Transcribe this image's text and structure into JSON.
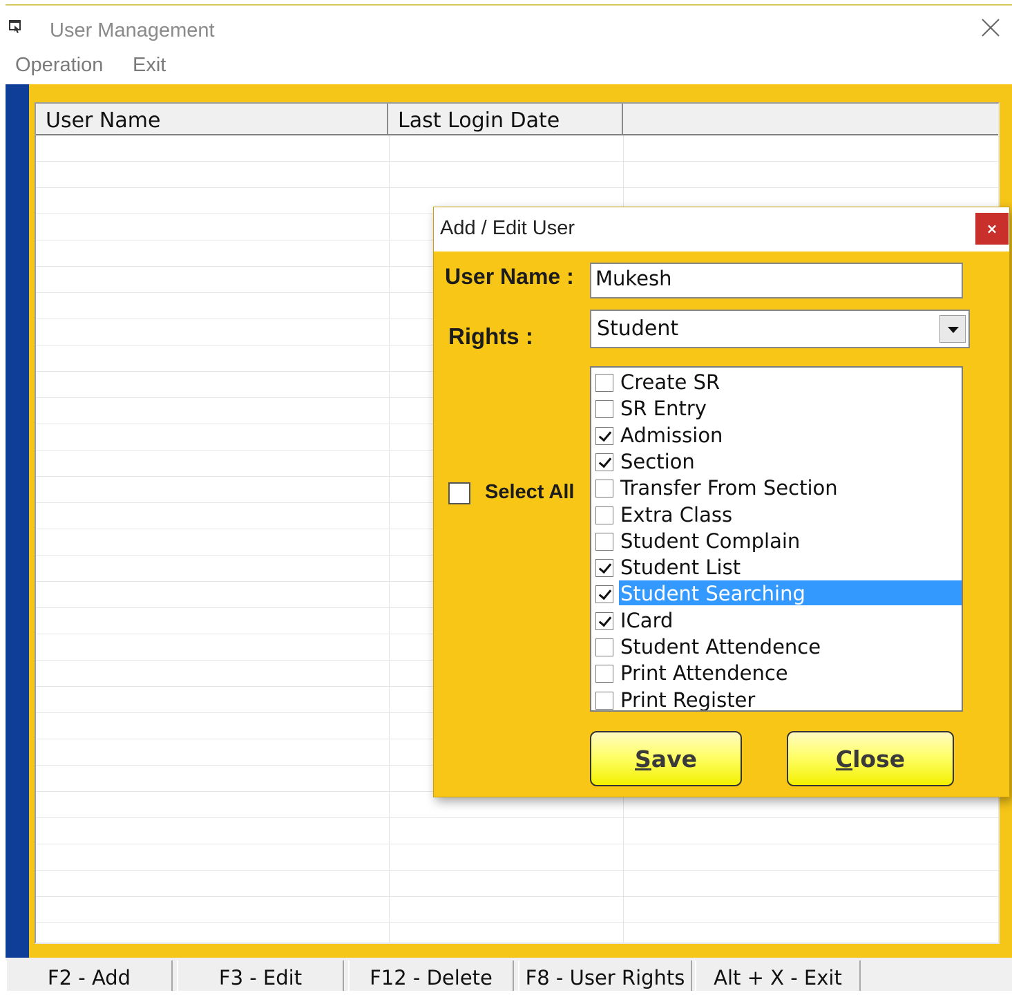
{
  "window": {
    "title": "User Management"
  },
  "menu": {
    "items": [
      "Operation",
      "Exit"
    ]
  },
  "grid": {
    "columns": [
      "User  Name",
      "Last Login Date",
      ""
    ]
  },
  "dialog": {
    "title": "Add / Edit User",
    "close_label": "×",
    "user_name_label": "User Name :",
    "user_name_value": "Mukesh",
    "rights_label": "Rights :",
    "rights_value": "Student",
    "select_all_label": "Select All",
    "select_all_checked": false,
    "rights_items": [
      {
        "label": "Create SR",
        "checked": false
      },
      {
        "label": "SR Entry",
        "checked": false
      },
      {
        "label": "Admission",
        "checked": true
      },
      {
        "label": "Section",
        "checked": true
      },
      {
        "label": "Transfer From Section",
        "checked": false
      },
      {
        "label": "Extra Class",
        "checked": false
      },
      {
        "label": "Student Complain",
        "checked": false
      },
      {
        "label": "Student List",
        "checked": true
      },
      {
        "label": "Student Searching",
        "checked": true,
        "selected": true
      },
      {
        "label": "ICard",
        "checked": true
      },
      {
        "label": "Student Attendence",
        "checked": false
      },
      {
        "label": "Print Attendence",
        "checked": false
      },
      {
        "label": "Print Register",
        "checked": false
      }
    ],
    "save_button": {
      "accel": "S",
      "rest": "ave"
    },
    "close_button": {
      "accel": "C",
      "rest": "lose"
    }
  },
  "keybar": {
    "keys": [
      "F2 - Add",
      "F3 - Edit",
      "F12 - Delete",
      "F8 - User Rights",
      "Alt + X - Exit"
    ]
  },
  "colors": {
    "accent_yellow": "#f5c518",
    "sidebar_blue": "#0f3e99",
    "selection_blue": "#3399ff",
    "close_red": "#c9302c"
  }
}
